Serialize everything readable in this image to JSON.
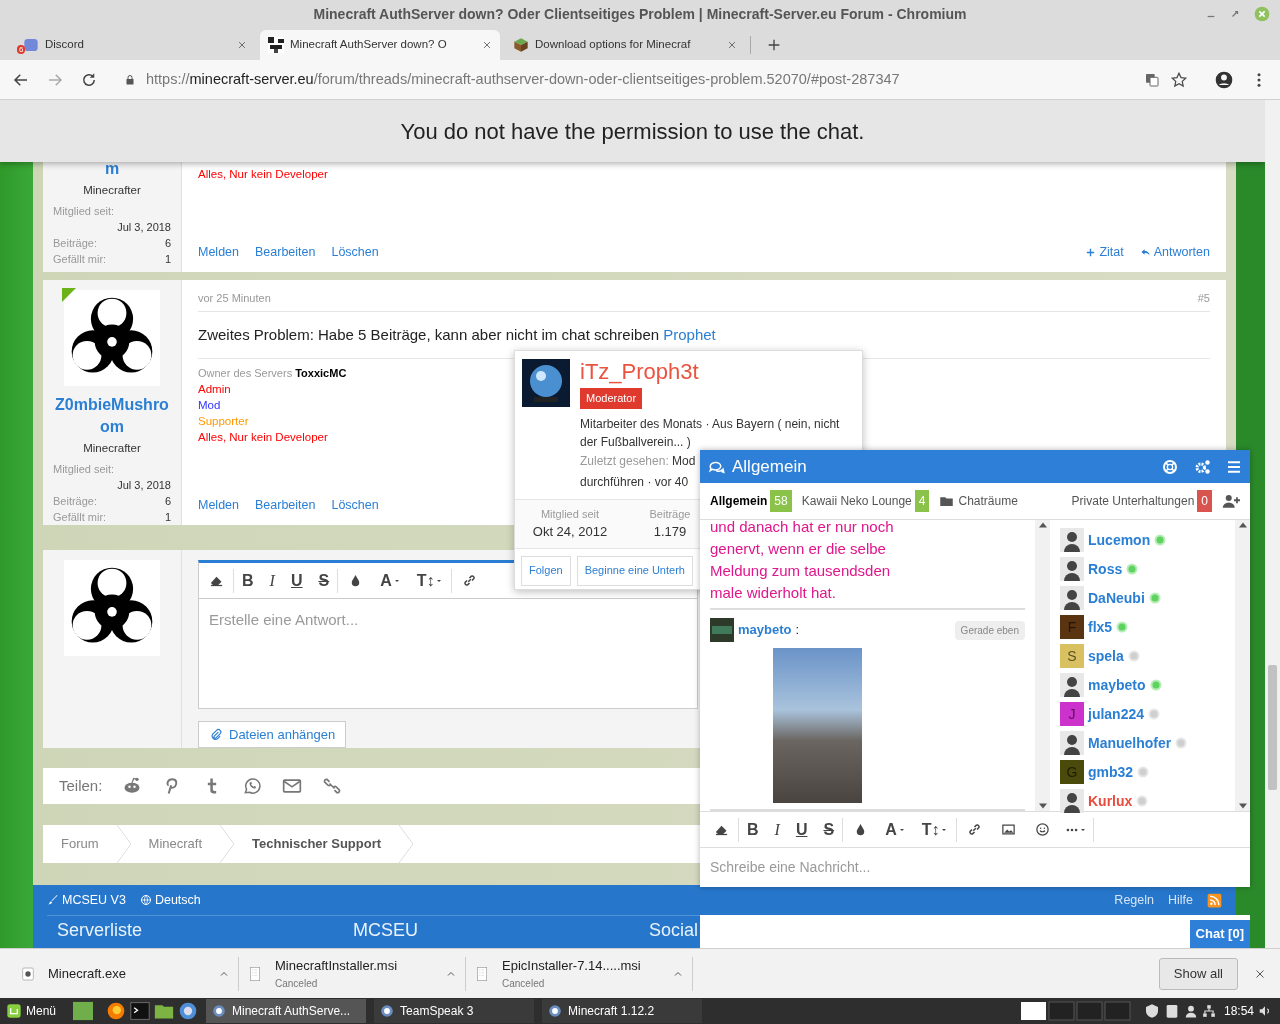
{
  "window": {
    "title": "Minecraft AuthServer down? Oder Clientseitiges Problem | Minecraft-Server.eu Forum - Chromium"
  },
  "tabs": [
    {
      "label": "Discord",
      "badge": "6",
      "selected": false
    },
    {
      "label": "Minecraft AuthServer down? O",
      "selected": true
    },
    {
      "label": "Download options for Minecraf",
      "selected": false
    }
  ],
  "address": {
    "scheme": "https://",
    "domain": "minecraft-server.eu",
    "path": "/forum/threads/minecraft-authserver-down-oder-clientseitiges-problem.52070/#post-287347"
  },
  "banner": "You do not have the permission to use the chat.",
  "posts": [
    {
      "user": {
        "name": "m",
        "title": "Minecrafter",
        "stats": [
          {
            "label": "Mitglied seit:",
            "value": "Jul 3, 2018"
          },
          {
            "label": "Beiträge:",
            "value": "6"
          },
          {
            "label": "Gefällt mir:",
            "value": "1"
          }
        ]
      },
      "roles": [
        {
          "text": "Alles, Nur kein Developer",
          "color": "#ff0000"
        }
      ],
      "actions": [
        "Melden",
        "Bearbeiten",
        "Löschen"
      ],
      "reply_actions": [
        "Zitat",
        "Antworten"
      ]
    },
    {
      "user": {
        "name": "Z0mbieMushroom",
        "title": "Minecrafter",
        "online": true,
        "stats": [
          {
            "label": "Mitglied seit:",
            "value": "Jul 3, 2018"
          },
          {
            "label": "Beiträge:",
            "value": "6"
          },
          {
            "label": "Gefällt mir:",
            "value": "1"
          }
        ]
      },
      "time": "vor 25 Minuten",
      "number": "#5",
      "message": "Zweites Problem: Habe 5 Beiträge, kann aber nicht im chat schreiben",
      "mention": "Prophet",
      "signature": "Owner des Servers **ToxxicMC**",
      "roles": [
        {
          "text": "Admin",
          "color": "#ff0000"
        },
        {
          "text": "Mod",
          "color": "#3333ff"
        },
        {
          "text": "Supporter",
          "color": "#ff9900"
        },
        {
          "text": "Alles, Nur kein Developer",
          "color": "#ff0000"
        }
      ],
      "actions": [
        "Melden",
        "Bearbeiten",
        "Löschen"
      ]
    }
  ],
  "reply": {
    "toolbar": [
      {
        "kind": "bold",
        "label": "B"
      },
      {
        "kind": "italic",
        "label": "I"
      },
      {
        "kind": "underline",
        "label": "U"
      },
      {
        "kind": "strike",
        "label": "S"
      },
      {
        "kind": "font",
        "label": "A"
      },
      {
        "kind": "size",
        "label": "T↕"
      }
    ],
    "placeholder": "Erstelle eine Antwort...",
    "attach": "Dateien anhängen"
  },
  "share": {
    "label": "Teilen:"
  },
  "breadcrumb": [
    "Forum",
    "Minecraft",
    "Technischer Support"
  ],
  "footer": {
    "style": "MCSEU V3",
    "language": "Deutsch",
    "links": [
      "Regeln",
      "Hilfe"
    ],
    "columns": [
      "Serverliste",
      "MCSEU",
      "Social"
    ]
  },
  "popup": {
    "name": "iTz_Proph3t",
    "badge": "Moderator",
    "about": "Mitarbeiter des Monats · Aus Bayern ( nein, nicht der Fußballverein... )",
    "last_seen_label": "Zuletzt gesehen:",
    "last_seen": "Mod",
    "last_seen_2": "durchführen · vor 40",
    "stats": [
      {
        "label": "Mitglied seit",
        "value": "Okt 24, 2012"
      },
      {
        "label": "Beiträge",
        "value": "1.179"
      }
    ],
    "buttons": [
      "Folgen",
      "Beginne eine Unterh"
    ]
  },
  "chat": {
    "title": "Allgemein",
    "rooms": [
      {
        "label": "Allgemein",
        "count": "58",
        "selected": true
      },
      {
        "label": "Kawaii Neko Lounge",
        "count": "4",
        "selected": false
      }
    ],
    "rooms_menu": "Chaträume",
    "private": {
      "label": "Private Unterhaltungen",
      "count": "0"
    },
    "messages": [
      {
        "kind": "text",
        "text": "und danach hat er nur noch genervt, wenn er die selbe Meldung zum tausendsden male widerholt hat."
      },
      {
        "kind": "image",
        "author": "maybeto",
        "separator": ":",
        "time": "Gerade eben"
      }
    ],
    "users": [
      {
        "name": "Lucemon",
        "online": true,
        "color": "#2a7fd4",
        "avatar": {
          "kind": "image"
        }
      },
      {
        "name": "Ross",
        "online": true,
        "color": "#2a7fd4",
        "avatar": {
          "kind": "image"
        }
      },
      {
        "name": "DaNeubi",
        "online": true,
        "color": "#2a7fd4",
        "avatar": {
          "kind": "image"
        }
      },
      {
        "name": "flx5",
        "online": true,
        "color": "#2a7fd4",
        "avatar": {
          "kind": "letter",
          "letter": "F",
          "color": "#5a3410"
        }
      },
      {
        "name": "spela",
        "online": false,
        "color": "#2a7fd4",
        "avatar": {
          "kind": "letter",
          "letter": "S",
          "color": "#d9c060"
        }
      },
      {
        "name": "maybeto",
        "online": true,
        "color": "#2a7fd4",
        "avatar": {
          "kind": "image"
        }
      },
      {
        "name": "julan224",
        "online": false,
        "color": "#2a7fd4",
        "avatar": {
          "kind": "letter",
          "letter": "J",
          "color": "#cc33cc"
        }
      },
      {
        "name": "Manuelhofer",
        "online": false,
        "color": "#2a7fd4",
        "avatar": {
          "kind": "image"
        }
      },
      {
        "name": "gmb32",
        "online": false,
        "color": "#2a7fd4",
        "avatar": {
          "kind": "letter",
          "letter": "G",
          "color": "#4a4a0a"
        }
      },
      {
        "name": "Kurlux",
        "online": false,
        "color": "#e84c3d",
        "avatar": {
          "kind": "image"
        }
      }
    ],
    "toolbar": [
      {
        "kind": "bold",
        "label": "B"
      },
      {
        "kind": "italic",
        "label": "I"
      },
      {
        "kind": "underline",
        "label": "U"
      },
      {
        "kind": "strike",
        "label": "S"
      },
      {
        "kind": "font",
        "label": "A"
      },
      {
        "kind": "size",
        "label": "T↕"
      }
    ],
    "placeholder": "Schreibe eine Nachricht...",
    "toggle": "Chat [0]"
  },
  "downloads": [
    {
      "name": "Minecraft.exe"
    },
    {
      "name": "MinecraftInstaller.msi",
      "status": "Canceled"
    },
    {
      "name": "EpicInstaller-7.14.....msi",
      "status": "Canceled"
    }
  ],
  "show_all": "Show all",
  "taskbar": {
    "menu": "Menü",
    "windows": [
      {
        "label": "Minecraft AuthServe...",
        "selected": true
      },
      {
        "label": "TeamSpeak 3",
        "selected": false
      },
      {
        "label": "Minecraft 1.12.2",
        "selected": false
      }
    ],
    "clock": "18:54"
  }
}
